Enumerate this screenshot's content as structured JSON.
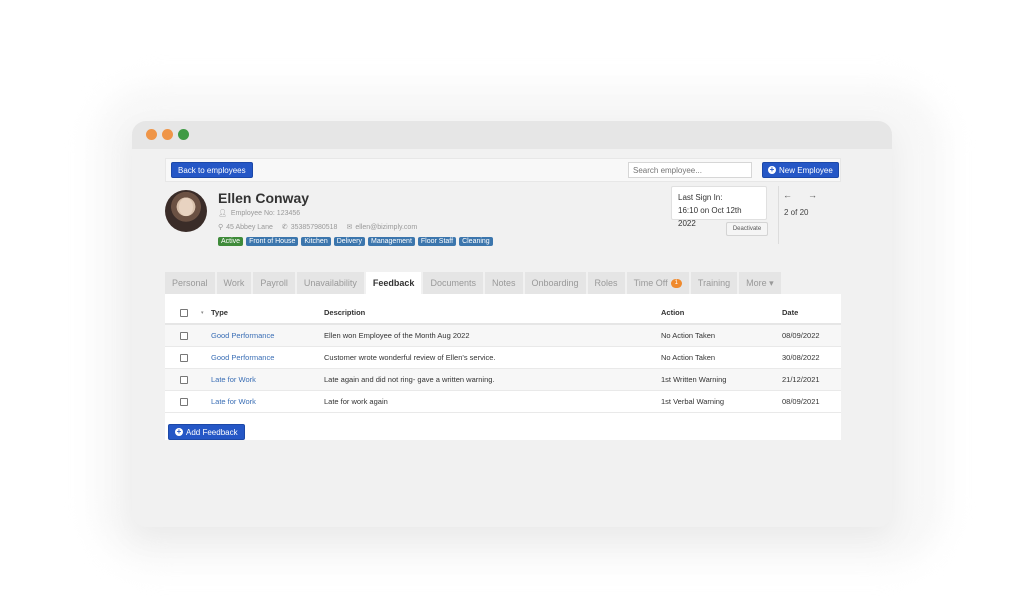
{
  "window": {
    "controls": [
      "close",
      "minimize",
      "maximize"
    ]
  },
  "topbar": {
    "back_label": "Back to employees",
    "search_placeholder": "Search employee...",
    "new_employee_label": "New Employee",
    "new_employee_icon": "plus-circle-icon"
  },
  "profile": {
    "name": "Ellen Conway",
    "employee_no": "Employee No: 123456",
    "address": "45 Abbey Lane",
    "phone": "353857980518",
    "email": "ellen@bizimply.com",
    "tags": [
      {
        "label": "Active",
        "color": "#3f8b3a"
      },
      {
        "label": "Front of House",
        "color": "#3c76ad"
      },
      {
        "label": "Kitchen",
        "color": "#3c76ad"
      },
      {
        "label": "Delivery",
        "color": "#3c76ad"
      },
      {
        "label": "Management",
        "color": "#3c76ad"
      },
      {
        "label": "Floor Staff",
        "color": "#3c76ad"
      },
      {
        "label": "Cleaning",
        "color": "#3c76ad"
      }
    ],
    "last_sign_in_label": "Last Sign In:",
    "last_sign_in_value": "16:10 on Oct 12th 2022",
    "deactivate_label": "Deactivate",
    "prev_arrow": "←",
    "next_arrow": "→",
    "position": "2 of 20"
  },
  "tabs": [
    {
      "label": "Personal",
      "active": false
    },
    {
      "label": "Work",
      "active": false
    },
    {
      "label": "Payroll",
      "active": false
    },
    {
      "label": "Unavailability",
      "active": false
    },
    {
      "label": "Feedback",
      "active": true
    },
    {
      "label": "Documents",
      "active": false
    },
    {
      "label": "Notes",
      "active": false
    },
    {
      "label": "Onboarding",
      "active": false
    },
    {
      "label": "Roles",
      "active": false
    },
    {
      "label": "Time Off",
      "active": false,
      "badge": "1"
    },
    {
      "label": "Training",
      "active": false
    },
    {
      "label": "More ▾",
      "active": false
    }
  ],
  "table": {
    "sort_icon": "▾",
    "columns": [
      "Type",
      "Description",
      "Action",
      "Date"
    ],
    "rows": [
      {
        "type": "Good Performance",
        "description": "Ellen won Employee of the Month Aug 2022",
        "action": "No Action Taken",
        "date": "08/09/2022"
      },
      {
        "type": "Good Performance",
        "description": "Customer wrote wonderful review of Ellen's service.",
        "action": "No Action Taken",
        "date": "30/08/2022"
      },
      {
        "type": "Late for Work",
        "description": "Late again and did not ring- gave a written warning.",
        "action": "1st Written Warning",
        "date": "21/12/2021"
      },
      {
        "type": "Late for Work",
        "description": "Late for work again",
        "action": "1st Verbal Warning",
        "date": "08/09/2021"
      }
    ]
  },
  "add_feedback_label": "Add Feedback",
  "colors": {
    "primary": "#2557c6",
    "link": "#3a6eb5",
    "badge": "#ef8a2e"
  }
}
